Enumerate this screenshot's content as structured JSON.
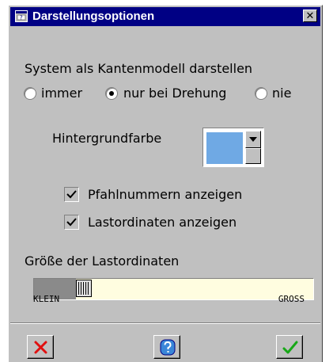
{
  "window": {
    "title": "Darstellungsoptionen",
    "close_label": "✕"
  },
  "wireframe": {
    "label": "System als Kantenmodell darstellen",
    "options": [
      "immer",
      "nur bei Drehung",
      "nie"
    ],
    "selected": "nur bei Drehung"
  },
  "background": {
    "label": "Hintergrundfarbe",
    "color": "#6fa9e4"
  },
  "checkboxes": [
    {
      "label": "Pfahlnummern anzeigen",
      "checked": true
    },
    {
      "label": "Lastordinaten anzeigen",
      "checked": true
    }
  ],
  "load_size": {
    "label": "Größe der Lastordinaten",
    "min_label": "KLEIN",
    "max_label": "GROSS",
    "value_fraction": 0.16
  },
  "buttons": {
    "cancel_icon": "red-x-icon",
    "help_icon": "help-question-icon",
    "ok_icon": "green-check-icon"
  }
}
